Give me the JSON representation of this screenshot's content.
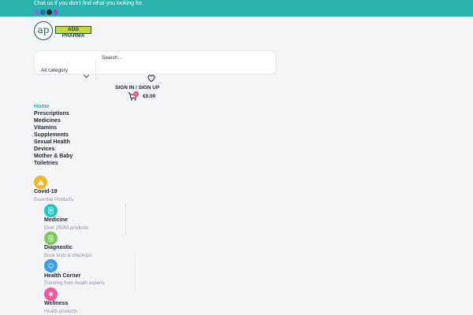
{
  "topbar": {
    "message": "Chat us if you don't find what you looking for.",
    "social_icons": [
      "facebook-icon",
      "twitter-icon",
      "instagram-icon",
      "linkedin-icon"
    ],
    "social_colors": [
      "#6e7bd9",
      "#1f6fb0",
      "#262b3a",
      "#7a5fd9"
    ],
    "background": "#2bb2ad"
  },
  "logo": {
    "mark": "ap",
    "name": "ADD PHARMA"
  },
  "search": {
    "category_label": "All category",
    "placeholder": "Search..."
  },
  "account": {
    "signin_label": "SIGN IN / SIGN UP"
  },
  "cart": {
    "count": "0",
    "total": "€0.00"
  },
  "nav": {
    "items": [
      "Home",
      "Prescriptions",
      "Medicines",
      "Vitamins",
      "Supplements",
      "Sexual Health",
      "Devices",
      "Mother & Baby",
      "Toiletries"
    ],
    "active_index": 0,
    "accent": "#2bb2ad"
  },
  "categories": [
    {
      "title": "Covid-19",
      "subtitle": "Essential Products",
      "icon": "warning-icon",
      "color": "#f4b71f"
    },
    {
      "title": "Medicine",
      "subtitle": "Over 25000 products",
      "icon": "document-icon",
      "color": "#2bc4c0"
    },
    {
      "title": "Diagnostic",
      "subtitle": "Book tests & checkups",
      "icon": "clipboard-icon",
      "color": "#7cc95c"
    },
    {
      "title": "Health Corner",
      "subtitle": "Trending from health experts",
      "icon": "heart-icon",
      "color": "#3b9ee6"
    },
    {
      "title": "Wellness",
      "subtitle": "Health products",
      "icon": "sparkle-icon",
      "color": "#ee5a9e"
    }
  ]
}
